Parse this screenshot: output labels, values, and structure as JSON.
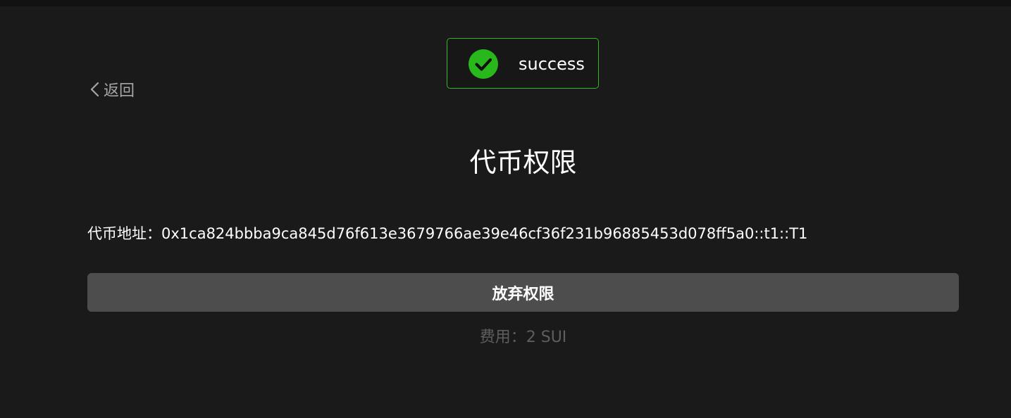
{
  "toast": {
    "icon": "check-circle-icon",
    "message": "success",
    "accent_color": "#2fb81f"
  },
  "nav": {
    "back_label": "返回",
    "back_icon": "chevron-left-icon"
  },
  "page": {
    "title": "代币权限"
  },
  "token": {
    "address_label": "代币地址：",
    "address_value": "0x1ca824bbba9ca845d76f613e3679766ae39e46cf36f231b96885453d078ff5a0::t1::T1"
  },
  "actions": {
    "relinquish_label": "放弃权限"
  },
  "fee": {
    "label": "费用：",
    "value": "2 SUI"
  }
}
